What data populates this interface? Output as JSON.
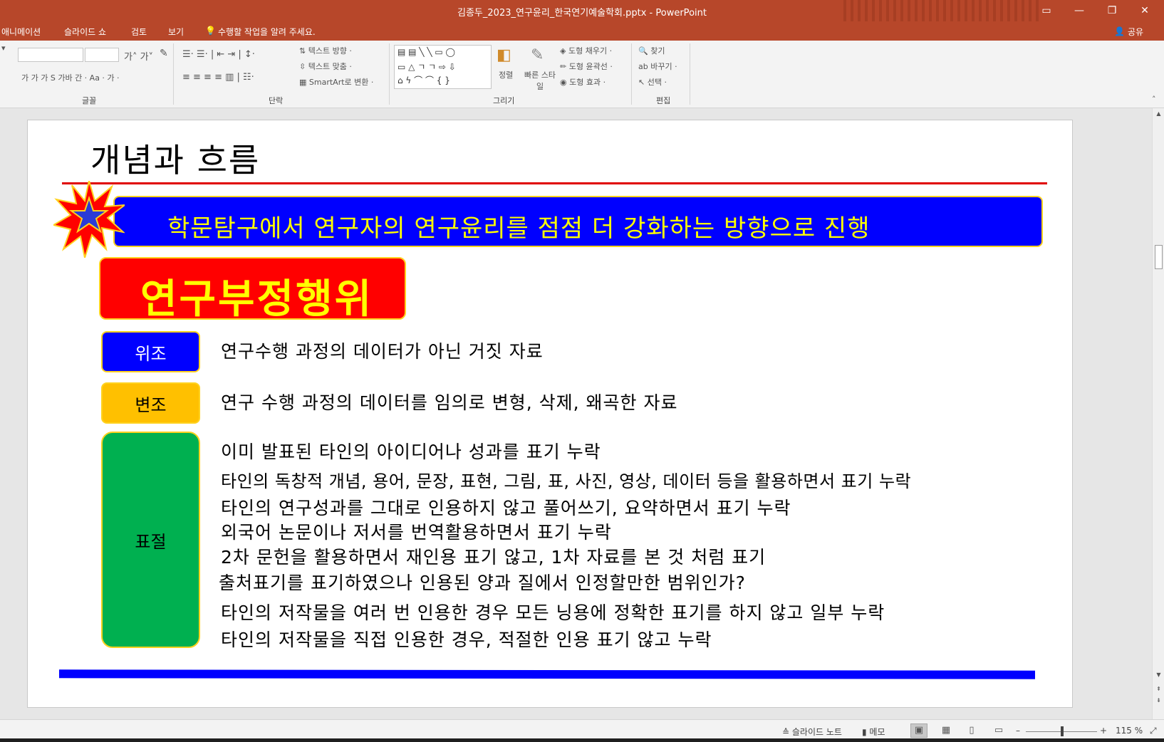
{
  "window": {
    "title": "김종두_2023_연구윤리_한국연기예술학회.pptx - PowerPoint"
  },
  "tabs": [
    "애니메이션",
    "슬라이드 쇼",
    "검토",
    "보기"
  ],
  "tell_me": "수행할 작업을 알려 주세요.",
  "share_label": "공유",
  "ribbon": {
    "font_group": "글꼴",
    "paragraph_group": "단락",
    "drawing_group": "그리기",
    "editing_group": "편집",
    "text_direction": "텍스트 방향",
    "align_text": "텍스트 맞춤",
    "smartart": "SmartArt로 변환",
    "arrange": "정렬",
    "quick_styles": "빠른 스타일",
    "shape_fill": "도형 채우기",
    "shape_outline": "도형 윤곽선",
    "shape_effects": "도형 효과",
    "find": "찾기",
    "replace": "바꾸기",
    "select": "선택"
  },
  "slide": {
    "title": "개념과 흐름",
    "banner": "학문탐구에서 연구자의 연구윤리를 점점 더 강화하는 방향으로 진행",
    "misconduct": "연구부정행위",
    "forgery_label": "위조",
    "forgery_text": "연구수행 과정의 데이터가 아닌 거짓 자료",
    "falsification_label": "변조",
    "falsification_text": "연구 수행 과정의 데이터를 임의로 변형, 삭제, 왜곡한 자료",
    "plagiarism_label": "표절",
    "plagiarism_lines": [
      "이미 발표된 타인의 아이디어나 성과를 표기 누락",
      "타인의 독창적 개념, 용어, 문장, 표현, 그림, 표, 사진, 영상, 데이터 등을 활용하면서 표기 누락",
      "타인의 연구성과를 그대로 인용하지 않고 풀어쓰기, 요약하면서 표기 누락",
      "외국어 논문이나 저서를 번역활용하면서 표기 누락",
      "2차 문헌을 활용하면서 재인용 표기 않고, 1차 자료를 본 것 처럼 표기",
      "출처표기를 표기하였으나 인용된 양과 질에서 인정할만한 범위인가?",
      "타인의 저작물을 여러 번 인용한 경우 모든 닝용에 정확한 표기를 하지 않고 일부 누락",
      "타인의 저작물을 직접 인용한 경우, 적절한 인용 표기 않고 누락"
    ]
  },
  "statusbar": {
    "notes": "슬라이드 노트",
    "comments": "메모",
    "zoom": "115 %"
  }
}
